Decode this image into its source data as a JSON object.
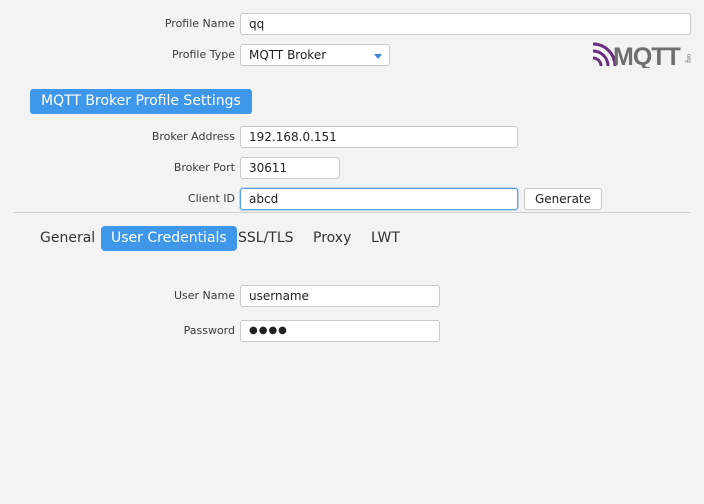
{
  "profile": {
    "name_label": "Profile Name",
    "name_value": "qq",
    "type_label": "Profile Type",
    "type_value": "MQTT Broker"
  },
  "logo": {
    "text": "MQTT",
    "sub": "org",
    "icon": "mqtt-logo"
  },
  "section": {
    "title": "MQTT Broker Profile Settings"
  },
  "broker": {
    "address_label": "Broker Address",
    "address_value": "192.168.0.151",
    "port_label": "Broker Port",
    "port_value": "30611",
    "client_label": "Client ID",
    "client_value": "abcd",
    "generate_label": "Generate"
  },
  "tabs": [
    {
      "label": "General",
      "active": false
    },
    {
      "label": "User Credentials",
      "active": true
    },
    {
      "label": "SSL/TLS",
      "active": false
    },
    {
      "label": "Proxy",
      "active": false
    },
    {
      "label": "LWT",
      "active": false
    }
  ],
  "credentials": {
    "username_label": "User Name",
    "username_value": "username",
    "password_label": "Password",
    "password_value": "●●●●"
  },
  "colors": {
    "accent": "#3f97ea",
    "focus": "#5aa0e6",
    "logo_purple": "#6b2d7e"
  }
}
